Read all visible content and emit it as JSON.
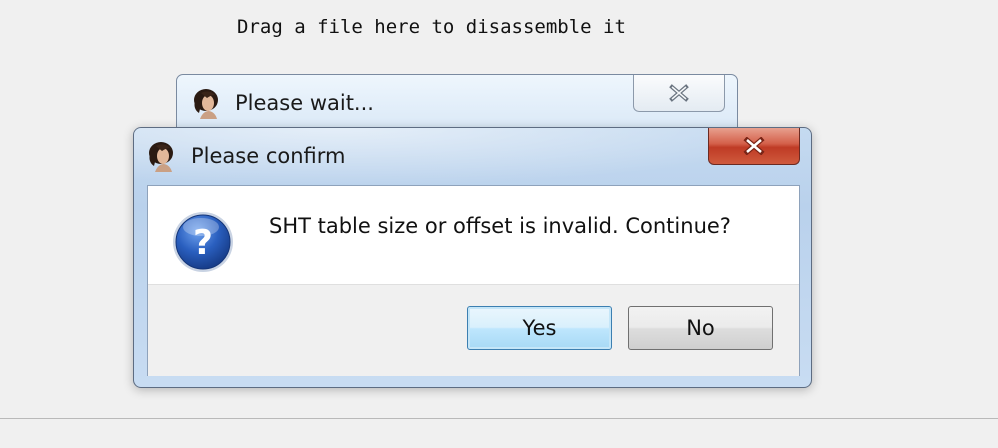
{
  "app": {
    "drop_hint": "Drag a file here to disassemble it"
  },
  "wait_window": {
    "title": "Please wait...",
    "icon": "portrait-icon",
    "close_icon": "close-icon"
  },
  "confirm_dialog": {
    "title": "Please confirm",
    "icon": "portrait-icon",
    "close_icon": "close-icon",
    "message_icon": "question-icon",
    "message": "SHT table size or offset is invalid. Continue?",
    "buttons": {
      "yes_label": "Yes",
      "no_label": "No"
    }
  },
  "colors": {
    "close_button_red": "#c9452d",
    "question_icon_blue": "#2a5fbf",
    "title_bar_blue": "#b9d1ec"
  }
}
